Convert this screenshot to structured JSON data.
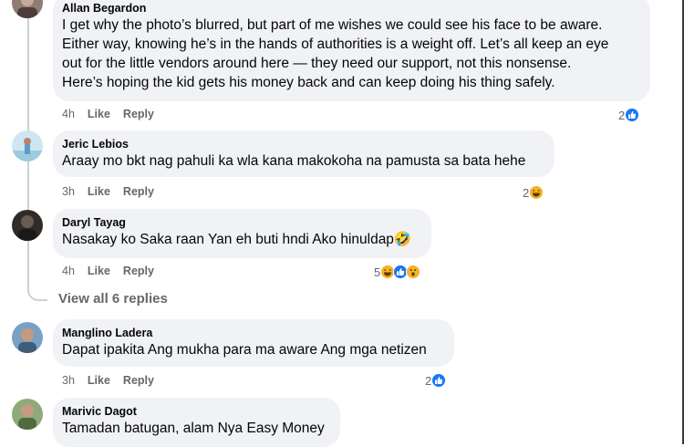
{
  "comments": [
    {
      "author": "Allan Begardon",
      "lines": [
        "I get why the photo’s blurred, but part of me wishes we could see his face to be aware.",
        "Either way, knowing he’s in the hands of authorities is a weight off. Let’s all keep an eye",
        "out for the little vendors around here — they need our support, not this nonsense.",
        "Here’s hoping the kid gets his money back and can keep doing his thing safely."
      ],
      "time": "4h",
      "like_label": "Like",
      "reply_label": "Reply",
      "reaction_count": "2",
      "reactions": [
        "like-icon"
      ]
    },
    {
      "author": "Jeric Lebios",
      "text": "Araay mo bkt nag pahuli ka wla kana makokoha na pamusta sa bata hehe",
      "time": "3h",
      "like_label": "Like",
      "reply_label": "Reply",
      "reaction_count": "2",
      "reactions": [
        "haha-icon"
      ]
    },
    {
      "author": "Daryl Tayag",
      "text": "Nasakay ko Saka raan Yan eh buti hndi Ako hinuldap🤣",
      "time": "4h",
      "like_label": "Like",
      "reply_label": "Reply",
      "reaction_count": "5",
      "reactions": [
        "haha-icon",
        "like-icon",
        "wow-icon"
      ]
    },
    {
      "author": "Manglino Ladera",
      "text": "Dapat ipakita Ang mukha para ma aware Ang mga netizen",
      "time": "3h",
      "like_label": "Like",
      "reply_label": "Reply",
      "reaction_count": "2",
      "reactions": [
        "like-icon"
      ]
    },
    {
      "author": "Marivic Dagot",
      "text": "Tamadan batugan, alam Nya Easy Money"
    }
  ],
  "view_replies_label": "View all 6 replies",
  "colors": {
    "bubble": "#f0f2f5",
    "meta_text": "#65676b",
    "like_blue": "#1877f2",
    "haha_yellow": "#f7b125",
    "thread_line": "#ced0d4"
  }
}
